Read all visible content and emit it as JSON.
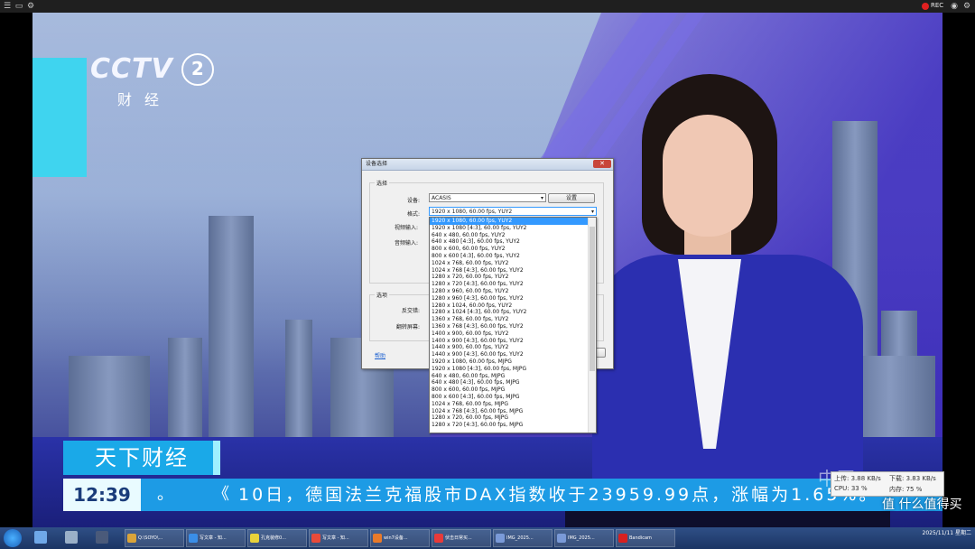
{
  "player": {
    "rec_label": "REC",
    "channel_logo": "CCTV",
    "channel_number": "2",
    "channel_sub": "财经",
    "program_title": "天下财经",
    "time": "12:39",
    "ticker_dot": "。",
    "ticker_mark": "《",
    "ticker_text": "10日，德国法兰克福股市DAX指数收于23959.99点，涨幅为1.65%。",
    "iptv_mark": "中国IPTV",
    "stats": {
      "up": "上传: 3.88 KB/s",
      "down": "下载: 3.83 KB/s",
      "cpu": "CPU: 33 %",
      "mem": "内存: 75 %"
    },
    "watermark": "值 什么值得买"
  },
  "dialog": {
    "title": "设备选择",
    "group_select": "选择",
    "device_label": "设备:",
    "device_value": "ACASIS",
    "settings_button": "设置",
    "format_label": "格式:",
    "format_value": "1920 x 1080, 60.00 fps, YUY2",
    "video_input_label": "视频输入:",
    "audio_input_label": "音频输入:",
    "group_options": "选项",
    "deinterlace_label": "反交错:",
    "flip_label": "翻转屏幕:",
    "help_link": "帮助",
    "format_options": [
      "1920 x 1080, 60.00 fps, YUY2",
      "1920 x 1080 [4:3], 60.00 fps, YUY2",
      "640 x 480, 60.00 fps, YUY2",
      "640 x 480 [4:3], 60.00 fps, YUY2",
      "800 x 600, 60.00 fps, YUY2",
      "800 x 600 [4:3], 60.00 fps, YUY2",
      "1024 x 768, 60.00 fps, YUY2",
      "1024 x 768 [4:3], 60.00 fps, YUY2",
      "1280 x 720, 60.00 fps, YUY2",
      "1280 x 720 [4:3], 60.00 fps, YUY2",
      "1280 x 960, 60.00 fps, YUY2",
      "1280 x 960 [4:3], 60.00 fps, YUY2",
      "1280 x 1024, 60.00 fps, YUY2",
      "1280 x 1024 [4:3], 60.00 fps, YUY2",
      "1360 x 768, 60.00 fps, YUY2",
      "1360 x 768 [4:3], 60.00 fps, YUY2",
      "1400 x 900, 60.00 fps, YUY2",
      "1400 x 900 [4:3], 60.00 fps, YUY2",
      "1440 x 900, 60.00 fps, YUY2",
      "1440 x 900 [4:3], 60.00 fps, YUY2",
      "1920 x 1080, 60.00 fps, MJPG",
      "1920 x 1080 [4:3], 60.00 fps, MJPG",
      "640 x 480, 60.00 fps, MJPG",
      "640 x 480 [4:3], 60.00 fps, MJPG",
      "800 x 600, 60.00 fps, MJPG",
      "800 x 600 [4:3], 60.00 fps, MJPG",
      "1024 x 768, 60.00 fps, MJPG",
      "1024 x 768 [4:3], 60.00 fps, MJPG",
      "1280 x 720, 60.00 fps, MJPG",
      "1280 x 720 [4:3], 60.00 fps, MJPG"
    ]
  },
  "taskbar": {
    "items": [
      {
        "label": "Q:\\SOYO\\...",
        "color": "#d9a43a"
      },
      {
        "label": "写文章 - 知...",
        "color": "#3a8ee8"
      },
      {
        "label": "孔克装修0...",
        "color": "#e8d23a"
      },
      {
        "label": "写文章 - 知...",
        "color": "#e84a3a"
      },
      {
        "label": "win7设备...",
        "color": "#e87a2a"
      },
      {
        "label": "伏击日常买...",
        "color": "#e83a3a"
      },
      {
        "label": "IMG_2025...",
        "color": "#7a9ad8"
      },
      {
        "label": "IMG_2025...",
        "color": "#7a9ad8"
      },
      {
        "label": "Bandicam",
        "color": "#d82020"
      }
    ],
    "tray_time": "",
    "tray_date": "2025/11/11 星期二"
  }
}
